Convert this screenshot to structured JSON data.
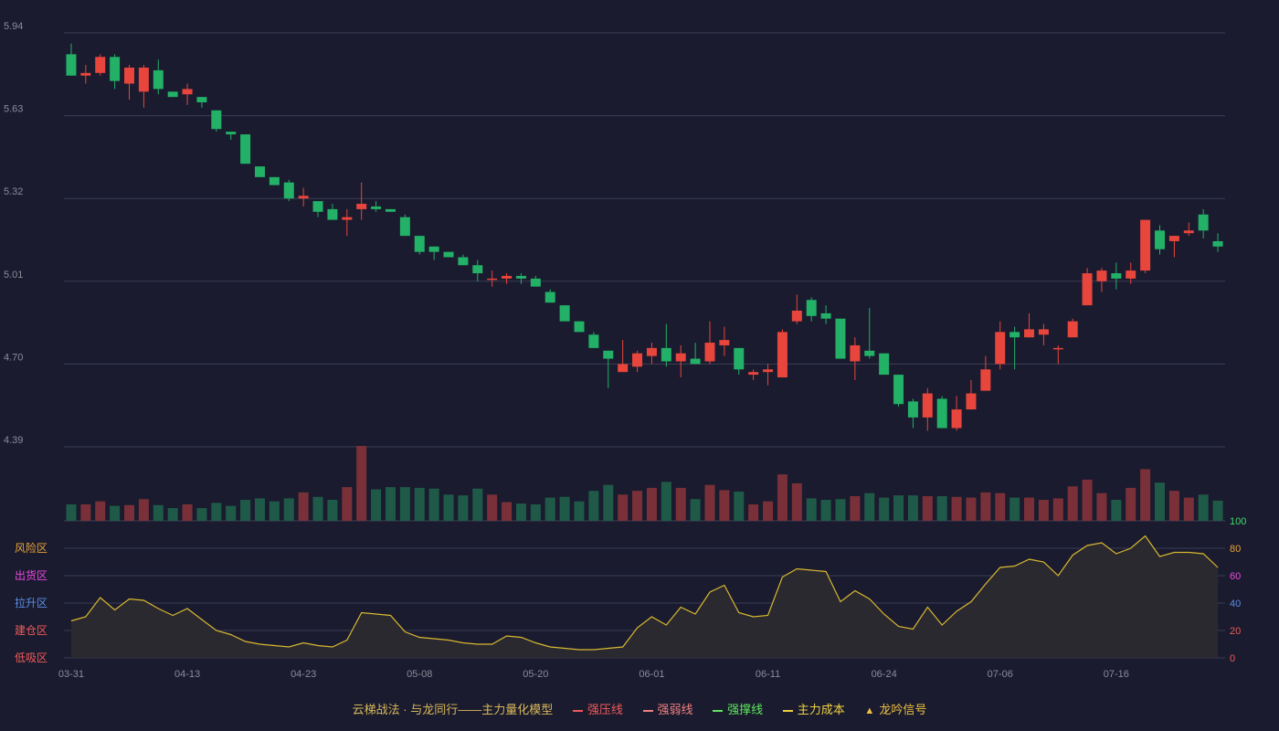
{
  "chart_data": {
    "type": "candlestick",
    "price_axis": {
      "ticks": [
        4.39,
        4.7,
        5.01,
        5.32,
        5.63,
        5.94
      ],
      "range": [
        4.39,
        5.94
      ]
    },
    "x_ticks": [
      {
        "index": 0,
        "label": "03-31"
      },
      {
        "index": 8,
        "label": "04-13"
      },
      {
        "index": 16,
        "label": "04-23"
      },
      {
        "index": 24,
        "label": "05-08"
      },
      {
        "index": 32,
        "label": "05-20"
      },
      {
        "index": 40,
        "label": "06-01"
      },
      {
        "index": 48,
        "label": "06-11"
      },
      {
        "index": 56,
        "label": "06-24"
      },
      {
        "index": 64,
        "label": "07-06"
      },
      {
        "index": 72,
        "label": "07-16"
      }
    ],
    "candles": [
      [
        5.86,
        5.78,
        5.9,
        5.78
      ],
      [
        5.78,
        5.79,
        5.82,
        5.75
      ],
      [
        5.79,
        5.85,
        5.86,
        5.78
      ],
      [
        5.85,
        5.76,
        5.86,
        5.73
      ],
      [
        5.75,
        5.81,
        5.82,
        5.69
      ],
      [
        5.72,
        5.81,
        5.82,
        5.66
      ],
      [
        5.8,
        5.73,
        5.84,
        5.71
      ],
      [
        5.72,
        5.7,
        5.72,
        5.7
      ],
      [
        5.71,
        5.73,
        5.75,
        5.67
      ],
      [
        5.7,
        5.68,
        5.7,
        5.66
      ],
      [
        5.65,
        5.58,
        5.65,
        5.57
      ],
      [
        5.57,
        5.56,
        5.57,
        5.54
      ],
      [
        5.56,
        5.45,
        5.56,
        5.45
      ],
      [
        5.44,
        5.4,
        5.44,
        5.4
      ],
      [
        5.4,
        5.37,
        5.4,
        5.37
      ],
      [
        5.38,
        5.32,
        5.39,
        5.31
      ],
      [
        5.32,
        5.33,
        5.36,
        5.29
      ],
      [
        5.31,
        5.27,
        5.31,
        5.25
      ],
      [
        5.28,
        5.24,
        5.3,
        5.24
      ],
      [
        5.24,
        5.25,
        5.28,
        5.18
      ],
      [
        5.28,
        5.3,
        5.38,
        5.24
      ],
      [
        5.29,
        5.28,
        5.31,
        5.27
      ],
      [
        5.28,
        5.27,
        5.28,
        5.27
      ],
      [
        5.25,
        5.18,
        5.26,
        5.18
      ],
      [
        5.18,
        5.12,
        5.18,
        5.11
      ],
      [
        5.14,
        5.12,
        5.14,
        5.09
      ],
      [
        5.12,
        5.1,
        5.12,
        5.1
      ],
      [
        5.1,
        5.07,
        5.11,
        5.07
      ],
      [
        5.07,
        5.04,
        5.09,
        5.01
      ],
      [
        5.02,
        5.02,
        5.05,
        4.99
      ],
      [
        5.02,
        5.03,
        5.04,
        5.0
      ],
      [
        5.03,
        5.02,
        5.04,
        5.0
      ],
      [
        5.02,
        4.99,
        5.03,
        4.99
      ],
      [
        4.97,
        4.93,
        4.98,
        4.93
      ],
      [
        4.92,
        4.86,
        4.92,
        4.86
      ],
      [
        4.86,
        4.82,
        4.86,
        4.82
      ],
      [
        4.81,
        4.76,
        4.82,
        4.76
      ],
      [
        4.75,
        4.72,
        4.75,
        4.61
      ],
      [
        4.67,
        4.7,
        4.79,
        4.67
      ],
      [
        4.69,
        4.74,
        4.75,
        4.67
      ],
      [
        4.73,
        4.76,
        4.78,
        4.7
      ],
      [
        4.76,
        4.71,
        4.85,
        4.69
      ],
      [
        4.71,
        4.74,
        4.77,
        4.65
      ],
      [
        4.72,
        4.7,
        4.78,
        4.7
      ],
      [
        4.71,
        4.78,
        4.86,
        4.7
      ],
      [
        4.77,
        4.79,
        4.84,
        4.73
      ],
      [
        4.76,
        4.68,
        4.76,
        4.66
      ],
      [
        4.66,
        4.67,
        4.68,
        4.64
      ],
      [
        4.67,
        4.68,
        4.7,
        4.62
      ],
      [
        4.65,
        4.82,
        4.83,
        4.65
      ],
      [
        4.86,
        4.9,
        4.96,
        4.85
      ],
      [
        4.94,
        4.88,
        4.95,
        4.86
      ],
      [
        4.89,
        4.87,
        4.92,
        4.85
      ],
      [
        4.87,
        4.72,
        4.87,
        4.72
      ],
      [
        4.71,
        4.77,
        4.8,
        4.64
      ],
      [
        4.75,
        4.73,
        4.91,
        4.72
      ],
      [
        4.74,
        4.66,
        4.74,
        4.66
      ],
      [
        4.66,
        4.55,
        4.66,
        4.54
      ],
      [
        4.56,
        4.5,
        4.57,
        4.46
      ],
      [
        4.5,
        4.59,
        4.61,
        4.45
      ],
      [
        4.57,
        4.46,
        4.58,
        4.46
      ],
      [
        4.46,
        4.53,
        4.58,
        4.45
      ],
      [
        4.53,
        4.59,
        4.64,
        4.53
      ],
      [
        4.6,
        4.68,
        4.73,
        4.6
      ],
      [
        4.7,
        4.82,
        4.86,
        4.68
      ],
      [
        4.82,
        4.8,
        4.84,
        4.68
      ],
      [
        4.8,
        4.83,
        4.89,
        4.8
      ],
      [
        4.81,
        4.83,
        4.85,
        4.77
      ],
      [
        4.76,
        4.76,
        4.77,
        4.7
      ],
      [
        4.8,
        4.86,
        4.87,
        4.8
      ],
      [
        4.92,
        5.04,
        5.06,
        4.92
      ],
      [
        5.01,
        5.05,
        5.06,
        4.97
      ],
      [
        5.04,
        5.02,
        5.08,
        4.98
      ],
      [
        5.02,
        5.05,
        5.08,
        5.0
      ],
      [
        5.05,
        5.24,
        5.24,
        5.04
      ],
      [
        5.2,
        5.13,
        5.22,
        5.11
      ],
      [
        5.16,
        5.18,
        5.18,
        5.1
      ],
      [
        5.19,
        5.2,
        5.23,
        5.18
      ],
      [
        5.26,
        5.2,
        5.28,
        5.17
      ],
      [
        5.16,
        5.14,
        5.19,
        5.12
      ]
    ],
    "volume": [
      22,
      22,
      26,
      20,
      21,
      29,
      21,
      17,
      22,
      17,
      24,
      20,
      28,
      30,
      26,
      30,
      38,
      32,
      28,
      45,
      100,
      42,
      45,
      45,
      44,
      43,
      35,
      34,
      43,
      35,
      25,
      23,
      22,
      31,
      32,
      26,
      40,
      48,
      35,
      40,
      44,
      52,
      44,
      29,
      48,
      41,
      39,
      22,
      26,
      62,
      50,
      30,
      28,
      29,
      33,
      37,
      31,
      34,
      34,
      33,
      33,
      32,
      31,
      38,
      37,
      31,
      31,
      28,
      30,
      46,
      55,
      37,
      28,
      44,
      69,
      51,
      40,
      31,
      35,
      27
    ],
    "oscillator": {
      "axis_ticks": [
        0,
        20,
        40,
        60,
        80,
        100
      ],
      "values": [
        27,
        30,
        44,
        35,
        43,
        42,
        36,
        31,
        36,
        28,
        20,
        17,
        12,
        10,
        9,
        8,
        11,
        9,
        8,
        13,
        33,
        32,
        31,
        19,
        15,
        14,
        13,
        11,
        10,
        10,
        16,
        15,
        11,
        8,
        7,
        6,
        6,
        7,
        8,
        22,
        30,
        24,
        37,
        32,
        48,
        53,
        33,
        30,
        31,
        59,
        65,
        64,
        63,
        41,
        49,
        43,
        32,
        23,
        21,
        37,
        24,
        34,
        41,
        54,
        66,
        67,
        72,
        70,
        60,
        75,
        82,
        84,
        76,
        80,
        89,
        74,
        77,
        77,
        76,
        66
      ],
      "zones": [
        {
          "label": "风险区",
          "level": 80,
          "color": "#e8a33a"
        },
        {
          "label": "出货区",
          "level": 60,
          "color": "#e94ae0"
        },
        {
          "label": "拉升区",
          "level": 40,
          "color": "#5b8ee6"
        },
        {
          "label": "建仓区",
          "level": 20,
          "color": "#f05a5a"
        },
        {
          "label": "低吸区",
          "level": 0,
          "color": "#f05a5a"
        }
      ],
      "tick_colors": {
        "100": "#3ddc6a",
        "80": "#e8a33a",
        "60": "#e94ae0",
        "40": "#5b8ee6",
        "20": "#f05a5a",
        "0": "#f05a5a"
      }
    },
    "colors": {
      "up": "#e8453c",
      "down": "#23b067",
      "vol_up": "#7a3038",
      "vol_down": "#1f5a48",
      "grid": "#3a3d55",
      "axis_text": "#8a8c99",
      "osc_line": "#d8b830",
      "osc_fill": "#2c2a30"
    }
  },
  "legend": {
    "title": "云梯战法 · 与龙同行——主力量化模型",
    "items": [
      {
        "label": "强压线",
        "color": "#f05a5a",
        "style": "solid"
      },
      {
        "label": "强弱线",
        "color": "#f08080",
        "style": "dashed"
      },
      {
        "label": "强撑线",
        "color": "#5ee65e",
        "style": "solid"
      },
      {
        "label": "主力成本",
        "color": "#f0d040",
        "style": "dashed"
      },
      {
        "label": "龙吟信号",
        "color": "#f0c040",
        "style": "triangle",
        "icon": "triangle-icon"
      }
    ]
  }
}
